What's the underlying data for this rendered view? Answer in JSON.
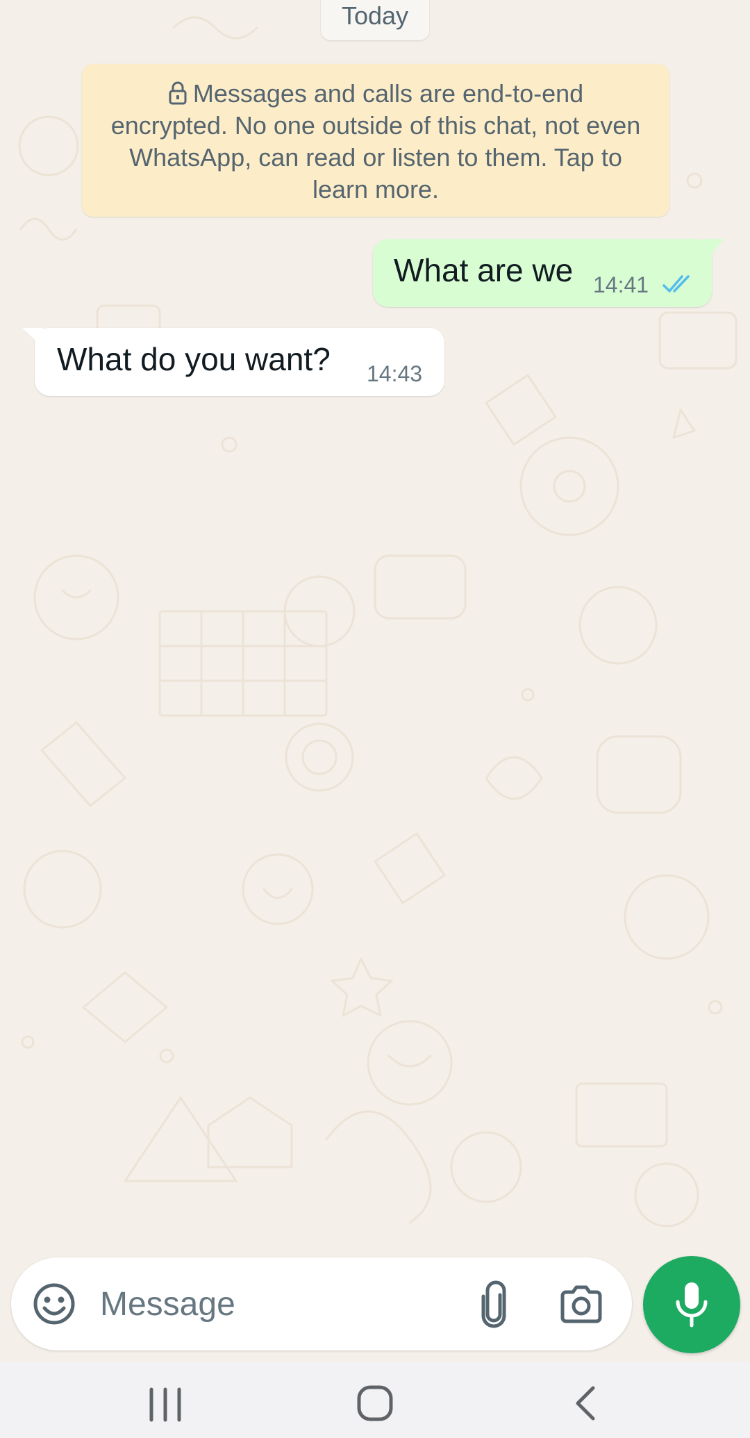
{
  "chat": {
    "date_label": "Today",
    "encryption_notice": "Messages and calls are end-to-end encrypted. No one outside of this chat, not even WhatsApp, can read or listen to them. Tap to learn more.",
    "messages": [
      {
        "direction": "outgoing",
        "text": "What are we",
        "time": "14:41",
        "status": "read"
      },
      {
        "direction": "incoming",
        "text": "What do you want?",
        "time": "14:43"
      }
    ]
  },
  "composer": {
    "placeholder": "Message"
  },
  "icons": {
    "emoji": "emoji-icon",
    "attach": "paperclip-icon",
    "camera": "camera-icon",
    "mic": "microphone-icon",
    "ticks": "double-check-icon",
    "lock": "lock-icon",
    "nav_recents": "recents-icon",
    "nav_home": "home-icon",
    "nav_back": "back-icon"
  },
  "colors": {
    "outgoing_bubble": "#d9fdd3",
    "incoming_bubble": "#ffffff",
    "notice_background": "#fdecc8",
    "accent_green": "#1daa61",
    "read_ticks": "#53bdeb",
    "chat_background": "#f4efe8"
  }
}
